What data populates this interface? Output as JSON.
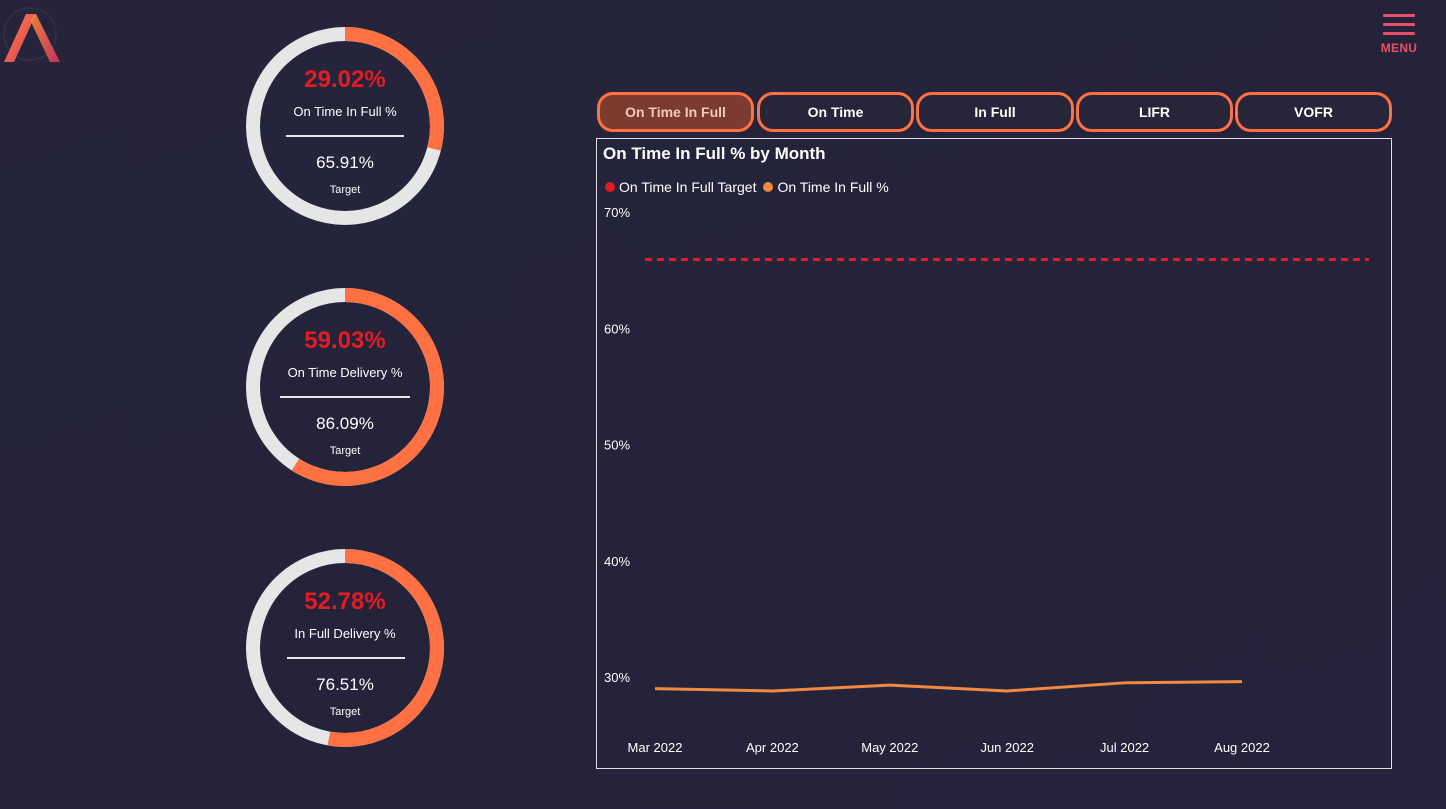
{
  "header": {
    "menu_label": "MENU"
  },
  "colors": {
    "accent": "#ff7043",
    "kpi_value": "#e31b23",
    "ring_track": "#e6e6e6",
    "target_line": "#e31b23",
    "actual_line": "#f08a40",
    "menu": "#e8506a"
  },
  "kpis": [
    {
      "value": "29.02%",
      "name": "On Time In Full %",
      "target_value": "65.91%",
      "target_label": "Target",
      "progress": 0.2902
    },
    {
      "value": "59.03%",
      "name": "On Time Delivery %",
      "target_value": "86.09%",
      "target_label": "Target",
      "progress": 0.5903
    },
    {
      "value": "52.78%",
      "name": "In Full Delivery %",
      "target_value": "76.51%",
      "target_label": "Target",
      "progress": 0.5278
    }
  ],
  "tabs": [
    {
      "label": "On Time In Full",
      "active": true
    },
    {
      "label": "On Time",
      "active": false
    },
    {
      "label": "In Full",
      "active": false
    },
    {
      "label": "LIFR",
      "active": false
    },
    {
      "label": "VOFR",
      "active": false
    }
  ],
  "chart_data": {
    "type": "line",
    "title": "On Time In Full % by Month",
    "categories": [
      "Mar 2022",
      "Apr 2022",
      "May 2022",
      "Jun 2022",
      "Jul 2022",
      "Aug 2022"
    ],
    "series": [
      {
        "name": "On Time In Full Target",
        "values": [
          65.91,
          65.91,
          65.91,
          65.91,
          65.91,
          65.91
        ],
        "style": "dashed",
        "color": "#e31b23"
      },
      {
        "name": "On Time In Full %",
        "values": [
          29.0,
          28.8,
          29.3,
          28.8,
          29.5,
          29.6
        ],
        "style": "solid",
        "color": "#f08a40"
      }
    ],
    "yticks": [
      "70%",
      "60%",
      "50%",
      "40%",
      "30%"
    ],
    "ylim": [
      26.7,
      70
    ],
    "xlabel": "",
    "ylabel": "",
    "grid": false,
    "legend_position": "top-left"
  }
}
